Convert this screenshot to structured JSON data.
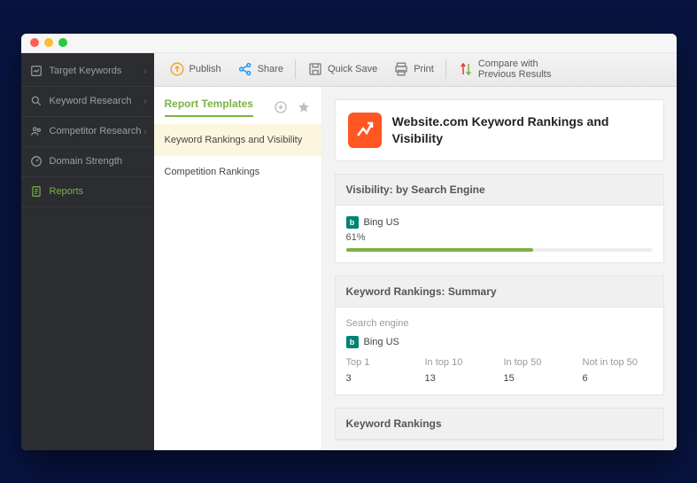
{
  "sidebar": {
    "items": [
      {
        "label": "Target Keywords",
        "expandable": true
      },
      {
        "label": "Keyword Research",
        "expandable": true
      },
      {
        "label": "Competitor Research",
        "expandable": true
      },
      {
        "label": "Domain Strength",
        "expandable": false
      },
      {
        "label": "Reports",
        "expandable": false
      }
    ],
    "active_index": 4
  },
  "toolbar": {
    "publish": "Publish",
    "share": "Share",
    "quick_save": "Quick Save",
    "print": "Print",
    "compare_line1": "Compare with",
    "compare_line2": "Previous Results"
  },
  "templates": {
    "title": "Report Templates",
    "items": [
      "Keyword Rankings and Visibility",
      "Competition Rankings"
    ],
    "selected_index": 0
  },
  "report": {
    "title": "Website.com Keyword Rankings and Visibility",
    "visibility": {
      "heading": "Visibility: by Search Engine",
      "engine": "Bing US",
      "percent_label": "61%",
      "percent_value": 61
    },
    "summary": {
      "heading": "Keyword Rankings: Summary",
      "search_engine_label": "Search engine",
      "engine": "Bing US",
      "columns": [
        "Top 1",
        "In top 10",
        "In top 50",
        "Not in top 50"
      ],
      "values": [
        "3",
        "13",
        "15",
        "6"
      ]
    },
    "rankings": {
      "heading": "Keyword Rankings"
    }
  }
}
